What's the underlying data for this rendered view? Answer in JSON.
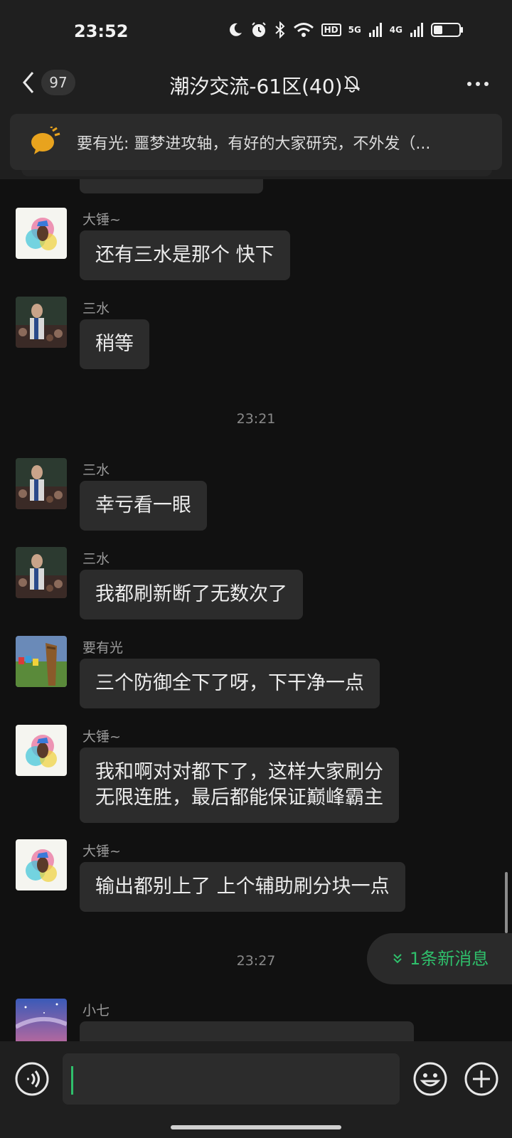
{
  "status_bar": {
    "time": "23:52",
    "hd_label": "HD",
    "net1_label": "5G",
    "net2_label": "4G",
    "icons": [
      "moon-icon",
      "alarm-icon",
      "bluetooth-icon",
      "wifi-icon",
      "signal-icon",
      "battery-icon"
    ]
  },
  "header": {
    "back_icon": "chevron-left-icon",
    "unread_count": "97",
    "title": "潮汐交流-61区(40)",
    "mute_icon": "bell-off-icon",
    "more_icon": "more-icon"
  },
  "pinned": {
    "icon": "announcement-icon",
    "text": "要有光: 噩梦进攻轴，有好的大家研究，不外发（..."
  },
  "messages": [
    {
      "sender": "大锤~",
      "text": "还有三水是那个 快下"
    },
    {
      "sender": "三水",
      "text": "稍等"
    },
    {
      "sender": "三水",
      "text": "幸亏看一眼"
    },
    {
      "sender": "三水",
      "text": "我都刷新断了无数次了"
    },
    {
      "sender": "要有光",
      "text": "三个防御全下了呀，下干净一点"
    },
    {
      "sender": "大锤~",
      "text": "我和啊对对都下了，这样大家刷分",
      "text2": "无限连胜，最后都能保证巅峰霸主"
    },
    {
      "sender": "大锤~",
      "text": "输出都别上了 上个辅助刷分块一点"
    },
    {
      "sender": "小七",
      "text": ""
    }
  ],
  "timestamps": [
    "23:21",
    "23:27"
  ],
  "new_messages": {
    "label": "1条新消息",
    "icon": "double-chevron-down-icon"
  },
  "accent_color": "#2fbf6b",
  "input_bar": {
    "voice_icon": "voice-icon",
    "emoji_icon": "emoji-icon",
    "plus_icon": "plus-icon",
    "value": ""
  }
}
